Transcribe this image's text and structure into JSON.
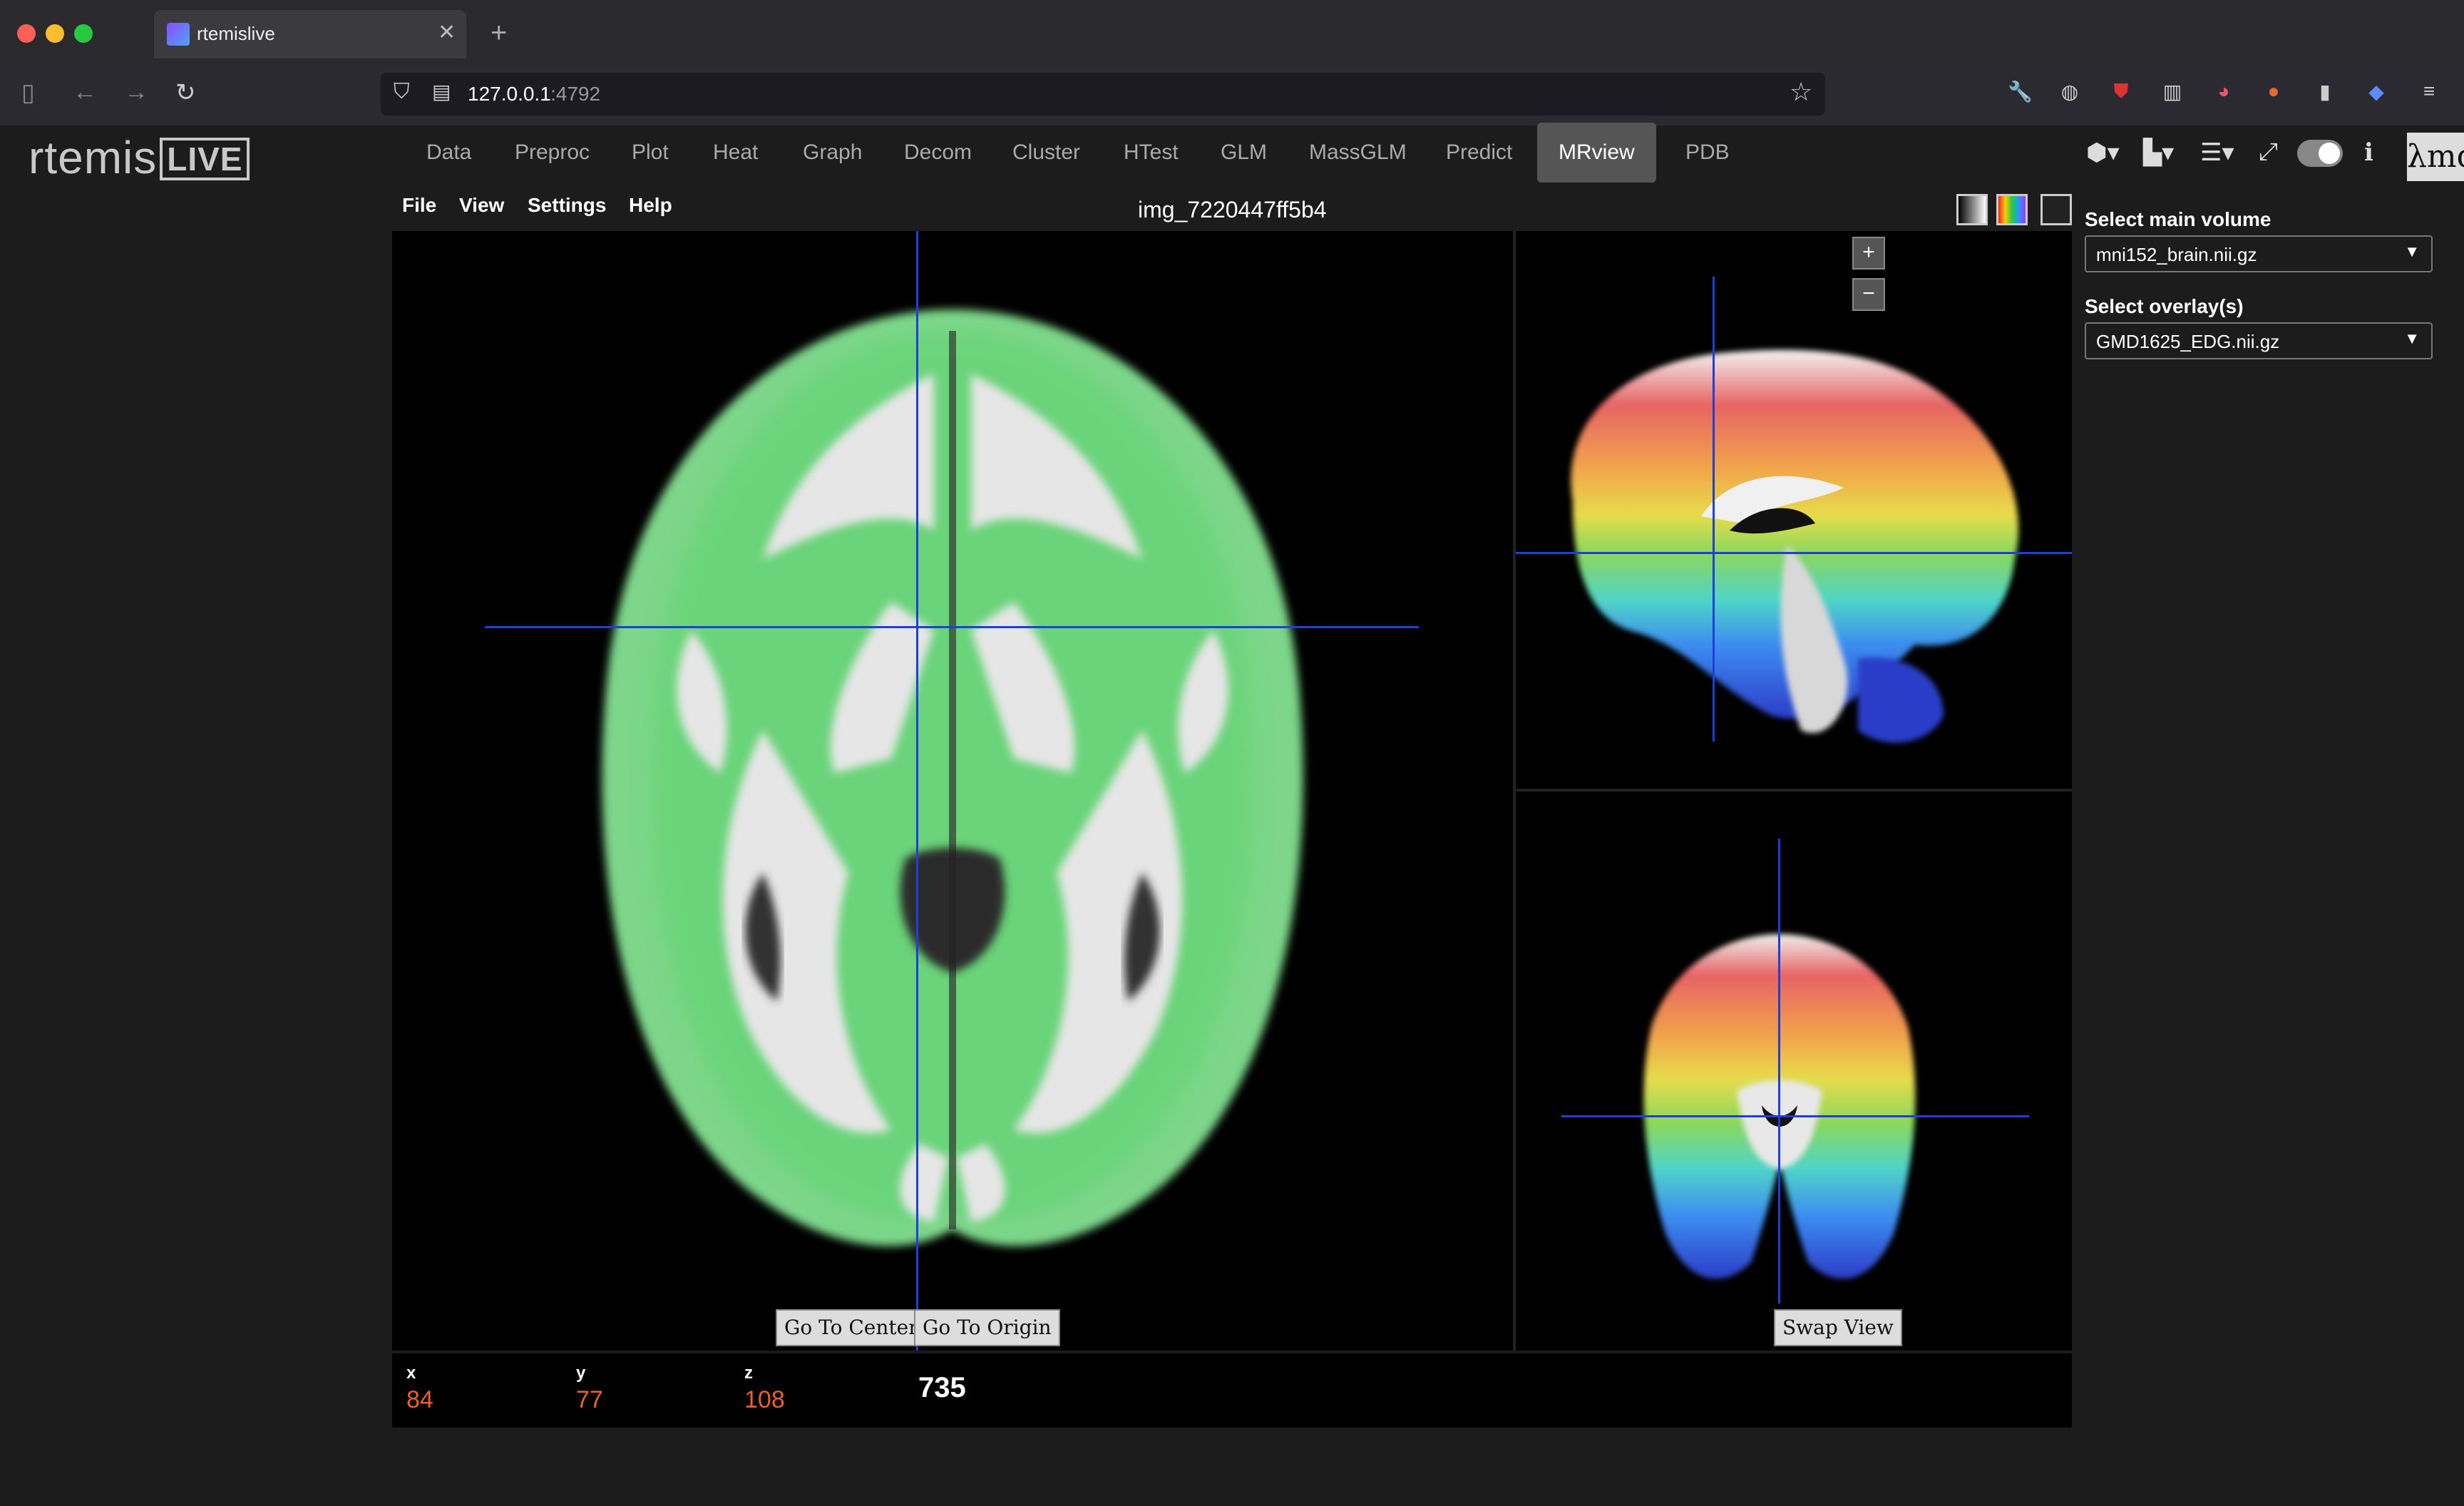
{
  "browser": {
    "tab_title": "rtemislive",
    "url_host": "127.0.0.1",
    "url_port": ":4792"
  },
  "app": {
    "logo_main": "rtemis",
    "logo_badge": "LIVE",
    "nav_tabs": [
      "Data",
      "Preproc",
      "Plot",
      "Heat",
      "Graph",
      "Decom",
      "Cluster",
      "HTest",
      "GLM",
      "MassGLM",
      "Predict",
      "MRview",
      "PDB"
    ],
    "active_tab": "MRview",
    "lambda_badge": "λmd"
  },
  "viewer": {
    "menus": [
      "File",
      "View",
      "Settings",
      "Help"
    ],
    "image_name": "img_7220447ff5b4",
    "zoom_in": "+",
    "zoom_out": "−",
    "go_to_center": "Go To Center",
    "go_to_origin": "Go To Origin",
    "swap_view": "Swap View",
    "coords": {
      "x_label": "x",
      "x_value": "84",
      "y_label": "y",
      "y_value": "77",
      "z_label": "z",
      "z_value": "108",
      "intensity": "735"
    },
    "crosshair_color": "#1e3fd8",
    "coord_value_color": "#e8632a"
  },
  "sidebar": {
    "main_volume_label": "Select main volume",
    "main_volume_value": "mni152_brain.nii.gz",
    "overlay_label": "Select overlay(s)",
    "overlay_value": "GMD1625_EDG.nii.gz"
  }
}
